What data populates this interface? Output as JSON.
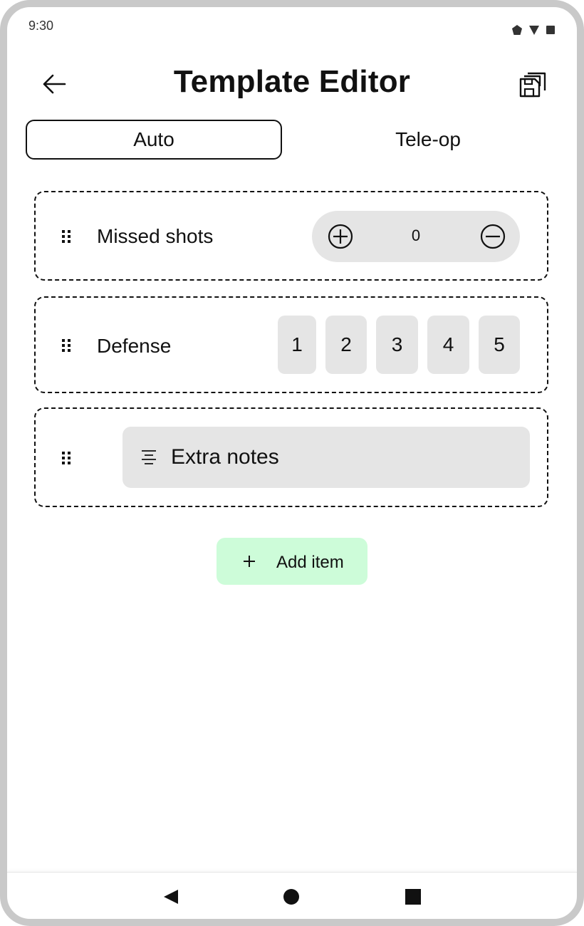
{
  "status_bar": {
    "time": "9:30",
    "icons": [
      "pentagon-icon",
      "signal-triangle-icon",
      "battery-square-icon"
    ]
  },
  "header": {
    "title": "Template Editor",
    "back_icon": "arrow-left-icon",
    "save_icon": "save-all-icon"
  },
  "tabs": [
    {
      "label": "Auto",
      "selected": true
    },
    {
      "label": "Tele-op",
      "selected": false
    }
  ],
  "items": [
    {
      "type": "counter",
      "label": "Missed shots",
      "value": "0",
      "icons": [
        "plus-circle-icon",
        "minus-circle-icon"
      ]
    },
    {
      "type": "rating",
      "label": "Defense",
      "options": [
        "1",
        "2",
        "3",
        "4",
        "5"
      ]
    },
    {
      "type": "text",
      "label": "Extra notes",
      "icon": "align-center-icon"
    }
  ],
  "add_button": {
    "label": "Add item",
    "icon": "plus-icon",
    "color": "#cdfcd9"
  },
  "nav_bar": {
    "icons": [
      "back-triangle-icon",
      "home-circle-icon",
      "recents-square-icon"
    ]
  }
}
